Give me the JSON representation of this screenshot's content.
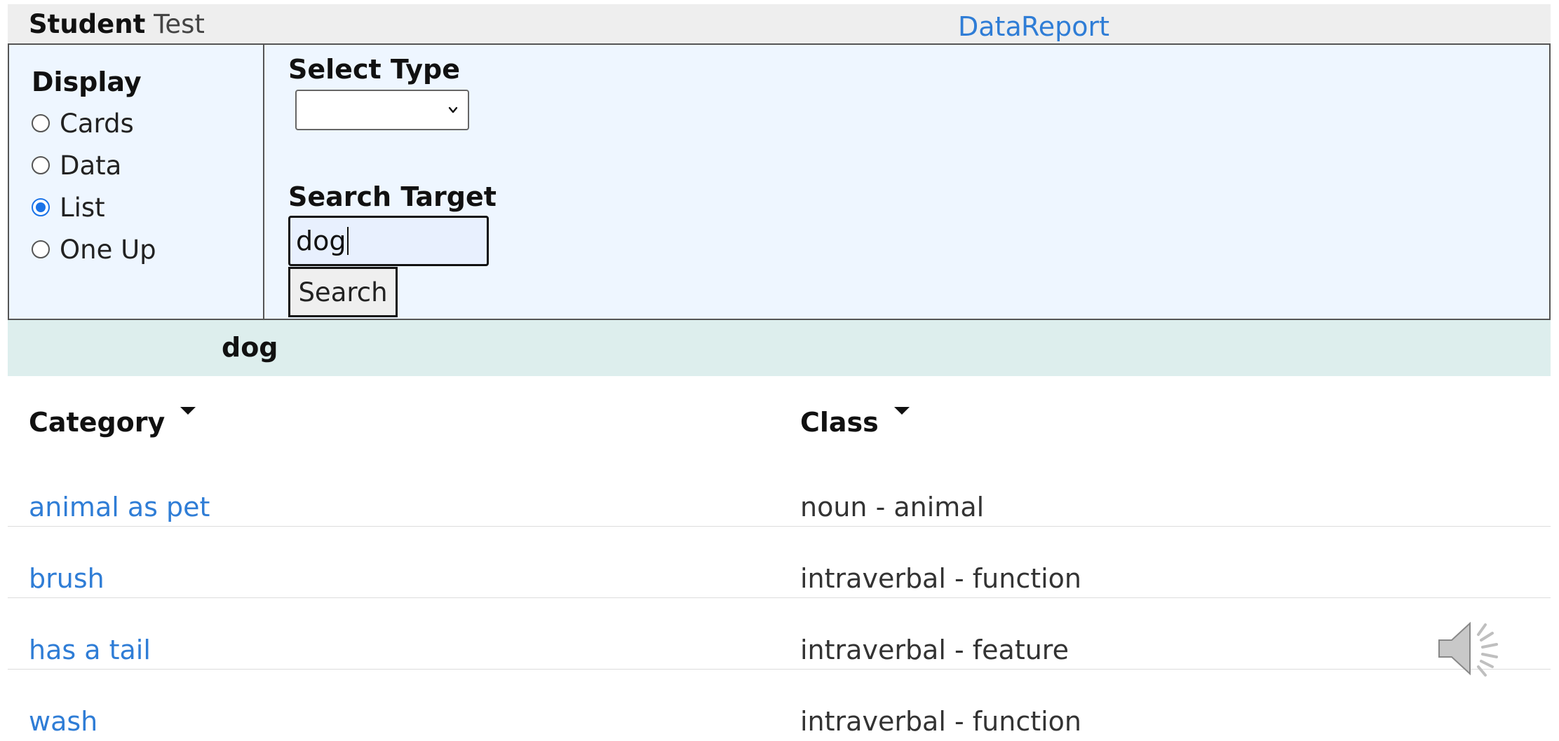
{
  "header": {
    "student_label": "Student",
    "student_name": "Test",
    "links": [
      "Data",
      "Report"
    ]
  },
  "display": {
    "title": "Display",
    "options": [
      {
        "label": "Cards",
        "checked": false
      },
      {
        "label": "Data",
        "checked": false
      },
      {
        "label": "List",
        "checked": true
      },
      {
        "label": "One Up",
        "checked": false
      }
    ]
  },
  "select_type": {
    "title": "Select Type",
    "value": ""
  },
  "search": {
    "title": "Search Target",
    "value": "dog",
    "button_label": "Search"
  },
  "target": {
    "word": "dog"
  },
  "table": {
    "headers": [
      "Category",
      "Class"
    ],
    "rows": [
      {
        "category": "animal as pet",
        "class": "noun - animal"
      },
      {
        "category": "brush",
        "class": "intraverbal - function"
      },
      {
        "category": "has a tail",
        "class": "intraverbal - feature"
      },
      {
        "category": "wash",
        "class": "intraverbal - function"
      }
    ]
  },
  "colors": {
    "link": "#2f7dd6",
    "panel_bg": "#eef6ff",
    "target_bar_bg": "#ddeeed",
    "radio_checked": "#1a73e8"
  },
  "icons": {
    "speaker": "speaker-volume-icon",
    "select_arrow": "chevron-down-icon",
    "sort": "sort-down-icon"
  }
}
